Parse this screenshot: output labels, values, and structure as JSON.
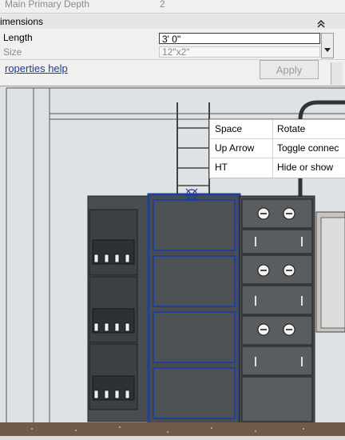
{
  "properties": {
    "rows": [
      {
        "label": "Main Primary Depth",
        "value": "2"
      },
      {
        "label": "imensions",
        "value": ""
      },
      {
        "label": "Length",
        "value": "3'  0\""
      },
      {
        "label": "Size",
        "value": "12\"x2\""
      }
    ],
    "collapse_icon": "double-chevron-up-icon",
    "help_link": "roperties help",
    "apply_label": "Apply"
  },
  "tooltip": {
    "rows": [
      {
        "key": "Space",
        "value": "Rotate"
      },
      {
        "key": "Up Arrow",
        "value": "Toggle connec"
      },
      {
        "key": "HT",
        "value": "Hide or show"
      }
    ]
  },
  "colors": {
    "selection_blue": "#1f3f9a",
    "panel": "#f0f0f0",
    "drawing_bg": "#dfe2e4",
    "cabinet": "#4a4d50"
  }
}
